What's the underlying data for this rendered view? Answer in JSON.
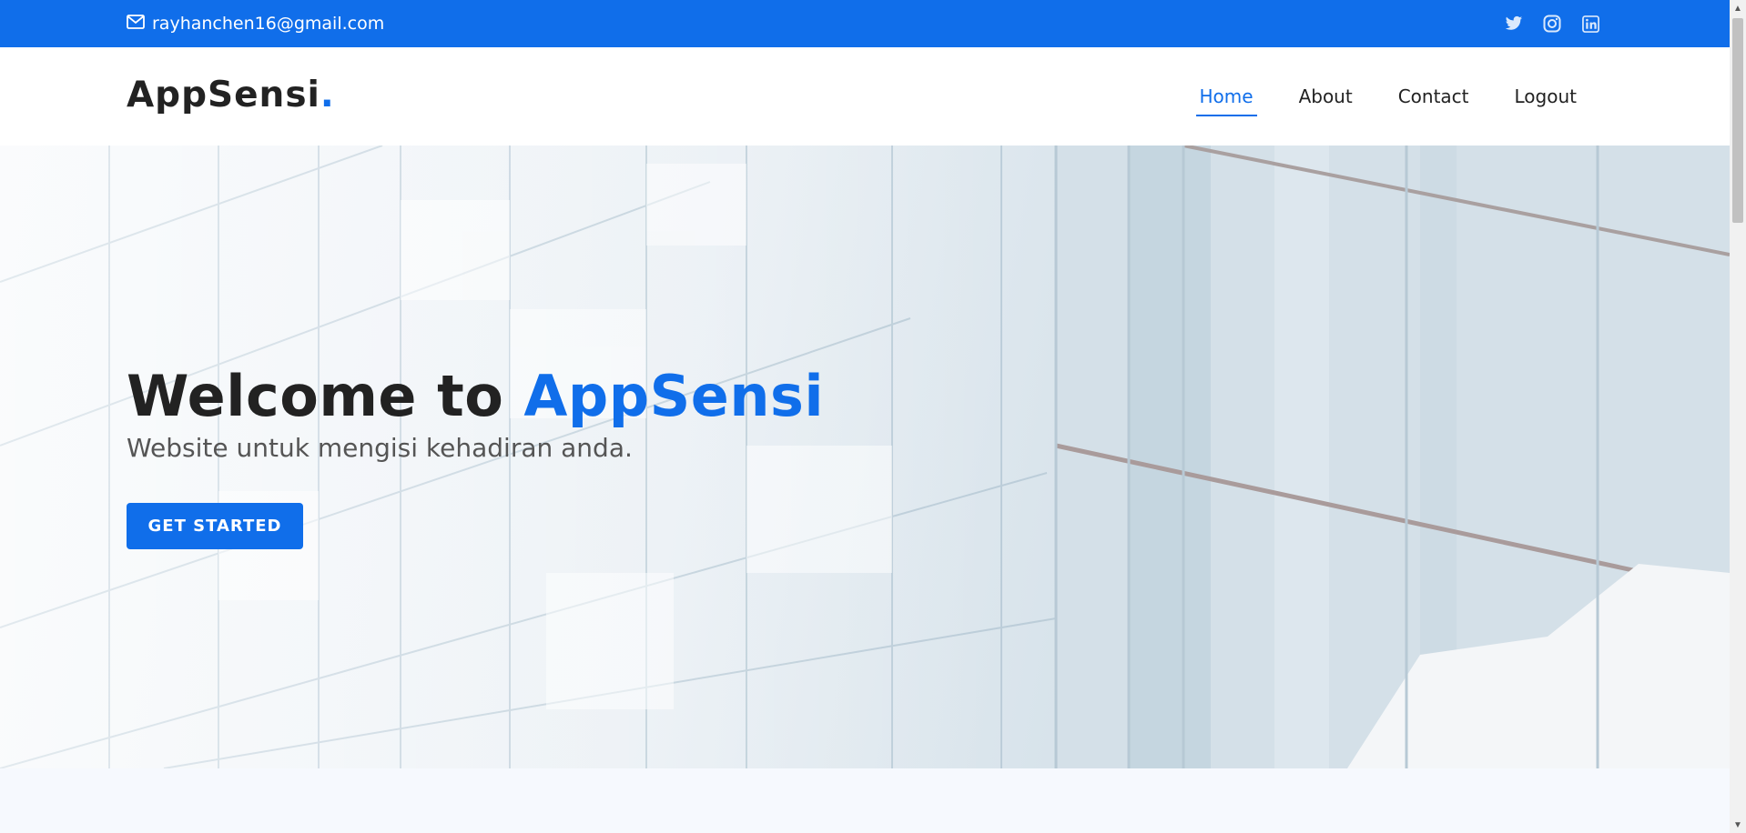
{
  "topbar": {
    "email": "rayhanchen16@gmail.com",
    "social_icons": [
      "twitter-icon",
      "instagram-icon",
      "linkedin-icon"
    ]
  },
  "header": {
    "logo_text": "AppSensi",
    "logo_dot": ".",
    "nav": [
      {
        "label": "Home",
        "active": true
      },
      {
        "label": "About",
        "active": false
      },
      {
        "label": "Contact",
        "active": false
      },
      {
        "label": "Logout",
        "active": false
      }
    ]
  },
  "hero": {
    "title_prefix": "Welcome to ",
    "title_brand": "AppSensi",
    "subtitle": "Website untuk mengisi kehadiran anda.",
    "cta_label": "GET STARTED"
  },
  "colors": {
    "accent": "#106eea",
    "text_dark": "#222222",
    "next_section_bg": "#f6f9fe"
  }
}
